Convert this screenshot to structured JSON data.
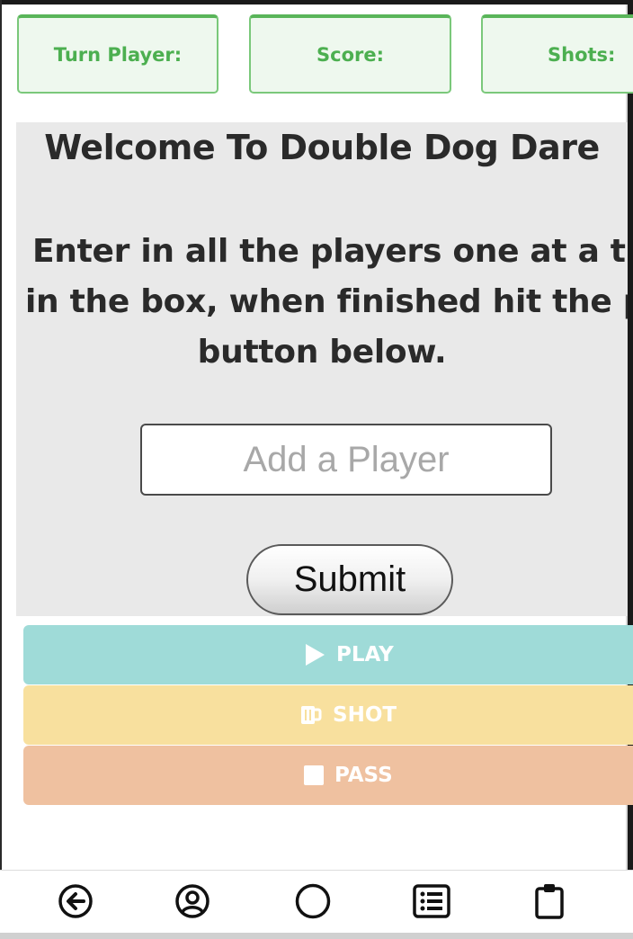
{
  "stats": {
    "turn_label": "Turn Player:",
    "score_label": "Score:",
    "shots_label": "Shots:"
  },
  "welcome": {
    "title": "Welcome To Double Dog Dare",
    "instruction_line1": "Enter in all the players one at a tir",
    "instruction_line2": "in the box, when finished hit the pl",
    "instruction_line3": "button below."
  },
  "form": {
    "player_placeholder": "Add a Player",
    "player_value": "",
    "submit_label": "Submit"
  },
  "actions": {
    "play_label": "PLAY",
    "shot_label": "SHOT",
    "pass_label": "PASS",
    "play_icon": "play-icon",
    "shot_icon": "beer-mug-icon",
    "pass_icon": "stop-icon"
  },
  "nav": {
    "items": [
      "back-arrow-icon",
      "user-circle-icon",
      "home-circle-icon",
      "list-icon",
      "clipboard-icon"
    ]
  },
  "colors": {
    "stat_text": "#4caf50",
    "play": "#9fdbd8",
    "shot": "#f8e09e",
    "pass": "#efc1a0"
  }
}
